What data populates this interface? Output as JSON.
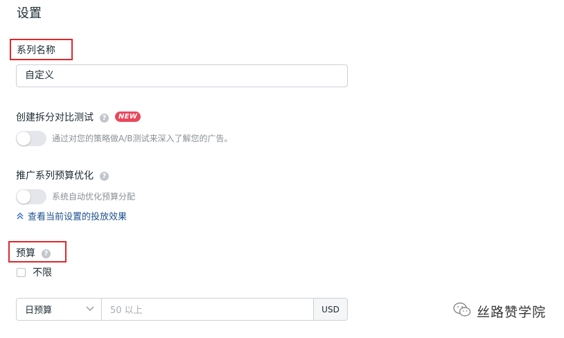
{
  "page": {
    "title": "设置"
  },
  "campaign_name": {
    "label": "系列名称",
    "value": "自定义"
  },
  "ab_test": {
    "label": "创建拆分对比测试",
    "badge": "NEW",
    "help_icon": "question-circle-icon",
    "toggle_on": false,
    "description": "通过对您的策略做A/B测试来深入了解您的广告。"
  },
  "cbo": {
    "label": "推广系列预算优化",
    "help_icon": "question-circle-icon",
    "toggle_on": false,
    "description": "系统自动优化预算分配"
  },
  "view_effect_link": {
    "label": "查看当前设置的投放效果",
    "icon": "chevron-up-double-icon"
  },
  "budget": {
    "label": "预算",
    "help_icon": "question-circle-icon",
    "unlimited_label": "不限",
    "unlimited_checked": false,
    "type_selected": "日预算",
    "amount_placeholder": "50 以上",
    "currency": "USD"
  },
  "watermark": {
    "text": "丝路赞学院",
    "icon": "wechat-icon"
  },
  "colors": {
    "highlight": "#e0262b",
    "badge": "#e9475c",
    "link": "#1c4f8f"
  }
}
